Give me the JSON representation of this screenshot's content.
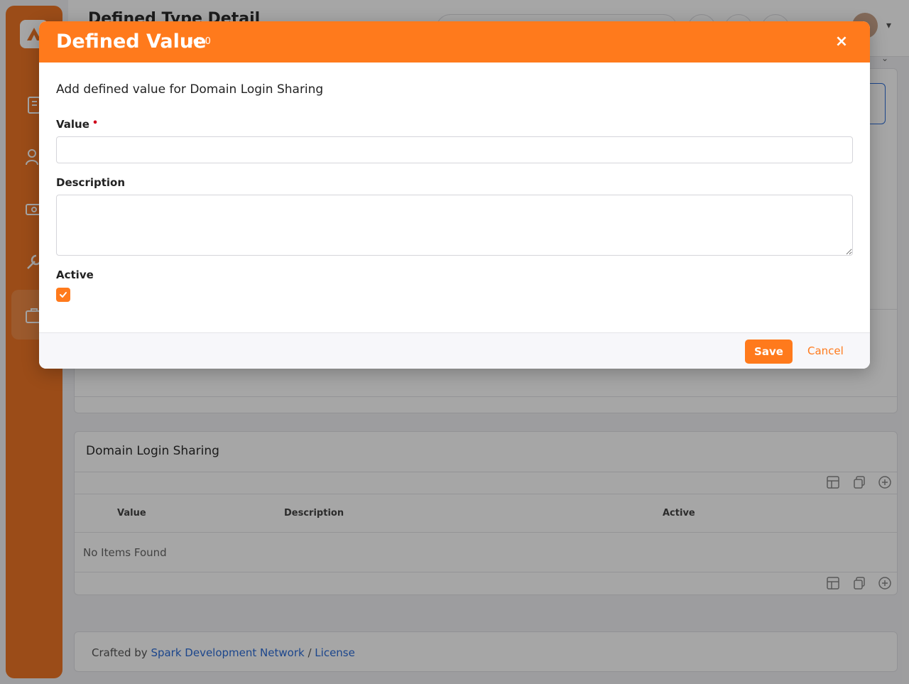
{
  "page": {
    "title": "Defined Type Detail"
  },
  "dls_panel": {
    "heading": "Domain Login Sharing",
    "columns": [
      "Value",
      "Description",
      "Active"
    ],
    "empty_text": "No Items Found"
  },
  "footer": {
    "prefix": "Crafted by",
    "org_link": "Spark Development Network",
    "separator": "/",
    "license_link": "License"
  },
  "modal": {
    "title": "Defined Value",
    "id_label": "Id: 0",
    "close_glyph": "×",
    "subtitle": "Add defined value for Domain Login Sharing",
    "value_label": "Value",
    "required_marker": "•",
    "value_input": "",
    "description_label": "Description",
    "description_input": "",
    "active_label": "Active",
    "active_checked": true,
    "save_label": "Save",
    "cancel_label": "Cancel"
  },
  "colors": {
    "accent": "#ff7a1c",
    "sidebar": "#ee7625",
    "link": "#2b6cd8",
    "required": "#d0021b"
  },
  "icons": {
    "close": "close-icon",
    "check": "check-icon",
    "grid": "grid-icon",
    "copy": "copy-icon",
    "add": "add-circle-icon"
  }
}
